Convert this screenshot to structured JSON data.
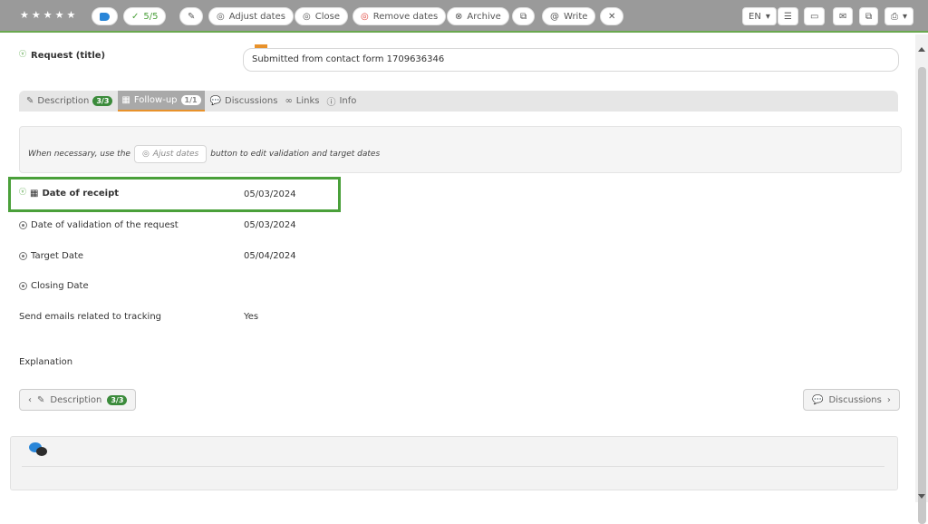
{
  "toolbar": {
    "stars": [
      "★",
      "★",
      "★",
      "★",
      "★"
    ],
    "check_count": "5/5",
    "adjust_dates": "Adjust dates",
    "close": "Close",
    "remove_dates": "Remove dates",
    "archive": "Archive",
    "write": "Write",
    "language": "EN"
  },
  "request": {
    "label": "Request (title)",
    "value": "Submitted from contact form 1709636346"
  },
  "tabs": [
    {
      "label": "Description",
      "badge": "3/3"
    },
    {
      "label": "Follow-up",
      "badge": "1/1"
    },
    {
      "label": "Discussions"
    },
    {
      "label": "Links"
    },
    {
      "label": "Info"
    }
  ],
  "info": {
    "before": "When necessary, use the",
    "button": "Ajust dates",
    "after": "button to edit validation and target dates"
  },
  "fields": {
    "receipt_label": "Date of receipt",
    "receipt_value": "05/03/2024",
    "validation_label": "Date of validation of the request",
    "validation_value": "05/03/2024",
    "target_label": "Target Date",
    "target_value": "05/04/2024",
    "closing_label": "Closing Date",
    "closing_value": "",
    "emails_label": "Send emails related to tracking",
    "emails_value": "Yes",
    "explanation_label": "Explanation"
  },
  "nav": {
    "prev_label": "Description",
    "prev_badge": "3/3",
    "next_label": "Discussions"
  },
  "colors": {
    "accent_green": "#4aa03a",
    "toolbar_gray": "#9a9a9a",
    "tab_underline": "#e8922b",
    "blue": "#2a86d8",
    "red": "#e0443c"
  }
}
